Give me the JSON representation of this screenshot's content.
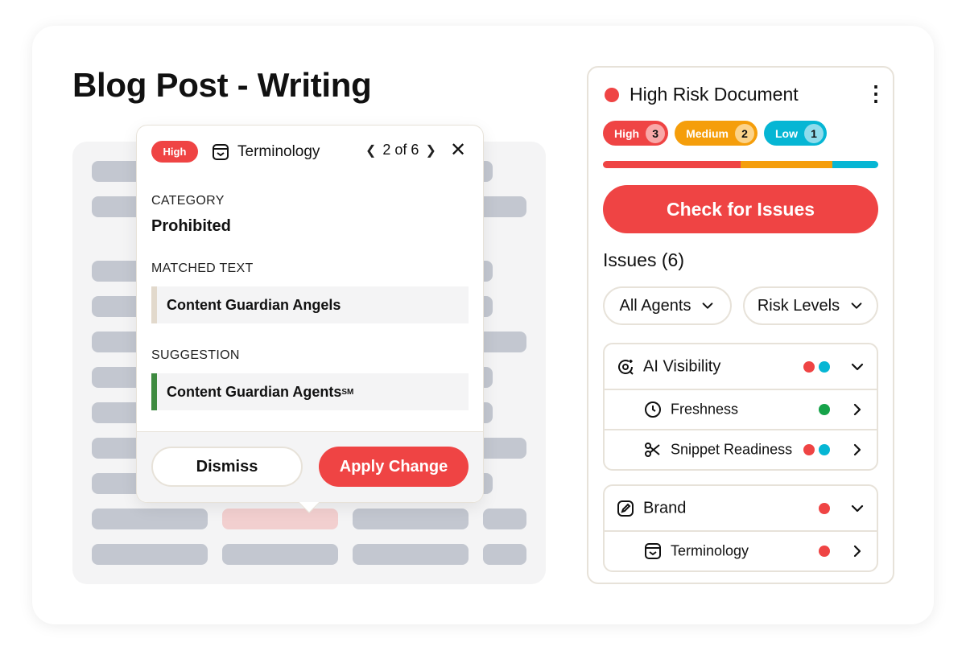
{
  "page": {
    "title": "Blog Post - Writing"
  },
  "popover": {
    "severity": "High",
    "agent": "Terminology",
    "pager": "2 of 6",
    "category_label": "CATEGORY",
    "category_value": "Prohibited",
    "matched_label": "MATCHED TEXT",
    "matched_value": "Content Guardian Angels",
    "suggestion_label": "SUGGESTION",
    "suggestion_value": "Content Guardian Agents",
    "suggestion_mark": "SM",
    "dismiss": "Dismiss",
    "apply": "Apply Change"
  },
  "panel": {
    "title": "High Risk Document",
    "badges": [
      {
        "label": "High",
        "count": "3",
        "color": "#ef4444",
        "count_bg": "#f9a8a8"
      },
      {
        "label": "Medium",
        "count": "2",
        "color": "#f59e0b",
        "count_bg": "#fcd38a"
      },
      {
        "label": "Low",
        "count": "1",
        "color": "#06b6d4",
        "count_bg": "#8fdcec"
      }
    ],
    "risk_split": {
      "high": 3,
      "medium": 2,
      "low": 1
    },
    "check_button": "Check for Issues",
    "issues_heading": "Issues (6)",
    "filters": {
      "agents": "All Agents",
      "risk": "Risk Levels"
    },
    "groups": [
      {
        "name": "AI Visibility",
        "icon": "ai-visibility-icon",
        "dots": [
          "#ef4444",
          "#06b6d4"
        ],
        "items": [
          {
            "name": "Freshness",
            "icon": "clock-icon",
            "dots": [
              "#16a34a"
            ]
          },
          {
            "name": "Snippet Readiness",
            "icon": "scissors-icon",
            "dots": [
              "#ef4444",
              "#06b6d4"
            ]
          }
        ]
      },
      {
        "name": "Brand",
        "icon": "brand-pen-icon",
        "dots": [
          "#ef4444"
        ],
        "items": [
          {
            "name": "Terminology",
            "icon": "terminology-icon",
            "dots": [
              "#ef4444"
            ]
          }
        ]
      }
    ]
  }
}
